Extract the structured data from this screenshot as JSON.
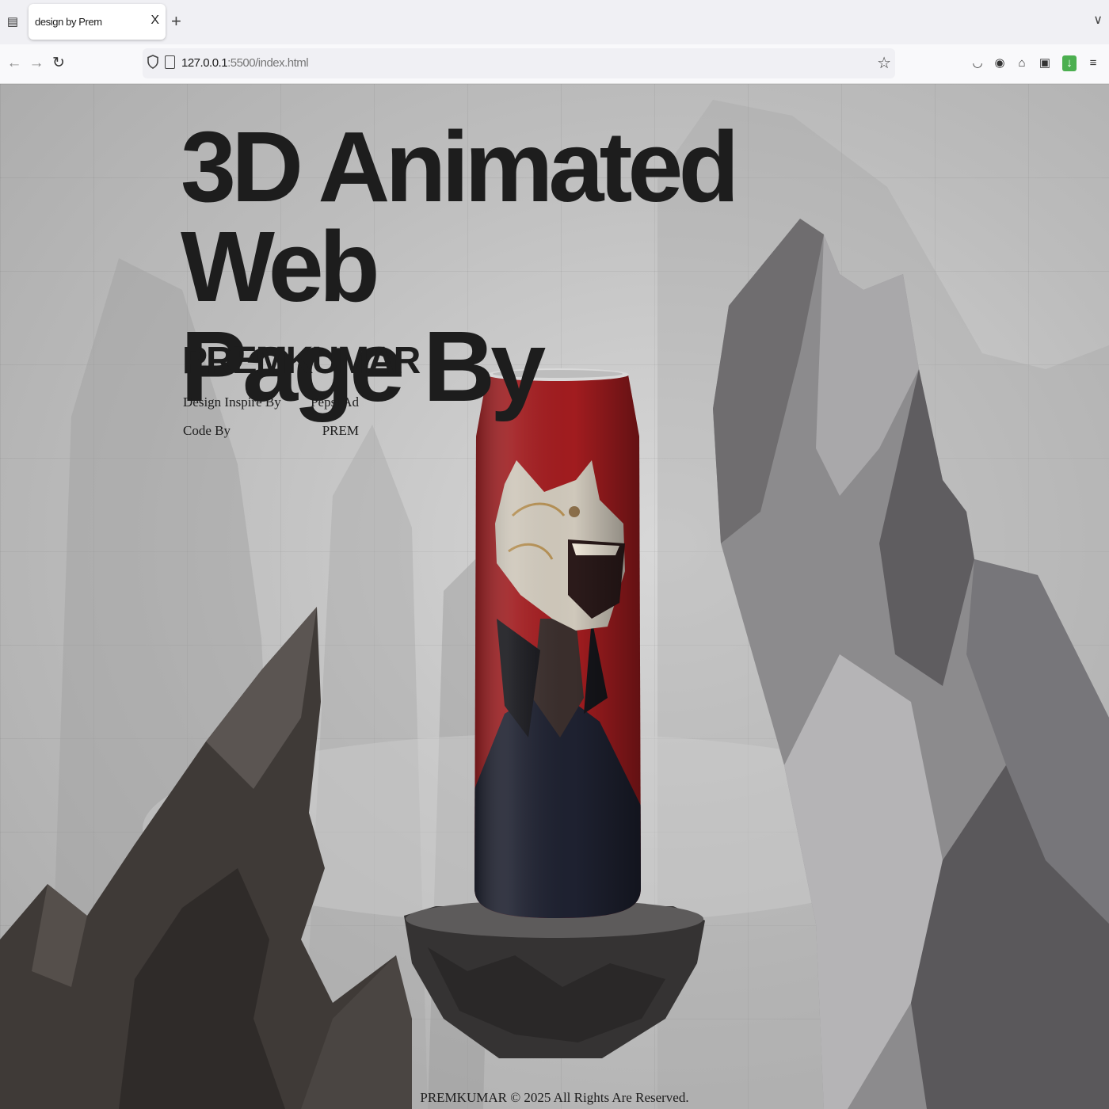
{
  "browser": {
    "tab_title": "design by Prem",
    "tab_close": "X",
    "new_tab": "+",
    "url_host": "127.0.0.1",
    "url_rest": ":5500/index.html"
  },
  "page": {
    "title_line1": "3D Animated Web",
    "title_line2": "Page By",
    "author": "PREMKUMAR",
    "credits": [
      {
        "label": "Design Inspire By",
        "value": "Pepsi Ad"
      },
      {
        "label": "Code By",
        "value": "PREM"
      }
    ],
    "footer": "PREMKUMAR © 2025 All Rights Are Reserved."
  },
  "colors": {
    "can_red": "#a11c1f",
    "rock_dark": "#3e3a38",
    "rock_light": "#8d8c8e"
  },
  "icons": [
    "tab-list-icon",
    "back-icon",
    "forward-icon",
    "reload-icon",
    "shield-icon",
    "page-icon",
    "bookmark-star-icon",
    "pocket-icon",
    "account-icon",
    "extensions-icon",
    "ext-icon",
    "download-icon",
    "menu-icon",
    "chevron-down-icon"
  ]
}
